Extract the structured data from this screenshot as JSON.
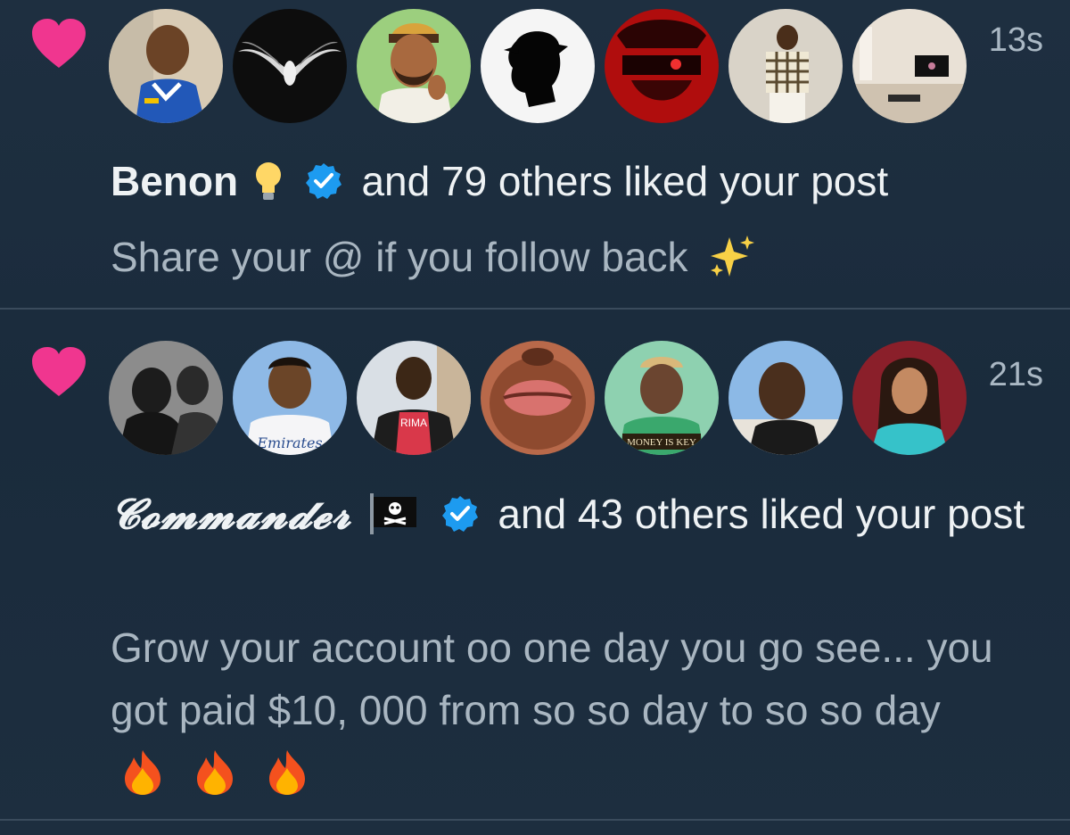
{
  "notifications": [
    {
      "time": "13s",
      "name": "Benon",
      "action": "and 79 others liked your post",
      "post_text": "Share your @ if you follow back",
      "post_emojis": "sparkles-icon",
      "avatars": [
        "avatar-person-blue-jersey",
        "avatar-eagle-dark",
        "avatar-cartoon-man",
        "avatar-silhouette-cap",
        "avatar-red-anime",
        "avatar-person-checkered-shirt",
        "avatar-living-room"
      ]
    },
    {
      "time": "21s",
      "name": "𝓒𝓸𝓶𝓶𝓪𝓷𝓭𝓮𝓻",
      "action": "and 43 others liked your post",
      "post_text": "Grow your account oo one day you go see... you got paid $10, 000 from so so day to so so day",
      "post_emojis": "fire-icon",
      "avatars": [
        "avatar-bw-group",
        "avatar-cartoon-footballer",
        "avatar-man-red-shirt",
        "avatar-closeup-lips",
        "avatar-cartoon-money-is-key",
        "avatar-man-selfie",
        "avatar-woman-teal"
      ]
    }
  ],
  "colors": {
    "background": "#1b2a3a",
    "heart": "#f0368f",
    "verified": "#1d9bf0",
    "divider": "#3a4b5c",
    "secondary_text": "#a9b6c1"
  },
  "avatar_texts": {
    "emirates": "Emirates",
    "money_is_key": "MONEY IS KEY",
    "rima": "RIMA"
  }
}
